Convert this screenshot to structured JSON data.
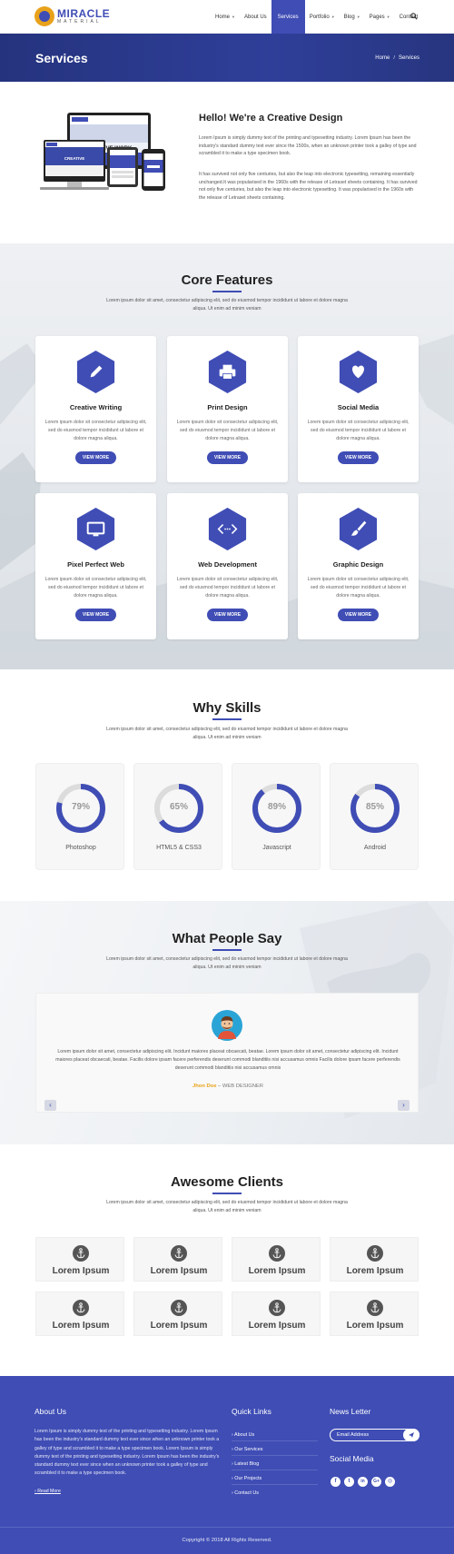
{
  "brand": {
    "name": "MIRACLE",
    "sub": "MATERIAL",
    "accent": "#3f4db5",
    "accent2": "#e8a21a"
  },
  "nav": {
    "items": [
      {
        "label": "Home",
        "caret": true
      },
      {
        "label": "About Us",
        "caret": false
      },
      {
        "label": "Services",
        "caret": false,
        "active": true
      },
      {
        "label": "Portfolio",
        "caret": true
      },
      {
        "label": "Blog",
        "caret": true
      },
      {
        "label": "Pages",
        "caret": true
      },
      {
        "label": "Contact",
        "caret": false
      }
    ],
    "caret_glyph": "▼",
    "search_icon": "search-icon"
  },
  "banner": {
    "title": "Services",
    "breadcrumb_home": "Home",
    "breadcrumb_sep": "/",
    "breadcrumb_current": "Services"
  },
  "intro": {
    "title": "Hello! We're a Creative Design",
    "p1": "Lorem Ipsum is simply dummy text of the printing and typesetting industry. Lorem Ipsum has been the industry's standard dummy text ever since the 1500s, when an unknown printer took a galley of type and scrambled it to make a type specimen book.",
    "p2": "It has survived not only five centuries, but also the leap into electronic typesetting, remaining essentially unchanged.It was popularised in the 1960s with the release of Letraset sheets containing. It has survived not only five centuries, but also the leap into electronic typesetting. It was popularised in the 1960s with the release of Letraset sheets containing.",
    "screen_text": "CREATIVE WORK",
    "screen_text2": "CREATIVE"
  },
  "features": {
    "title": "Core Features",
    "desc": "Lorem ipsum dolor sit amet, consectetur adipiscing elit, sed do eiusmod tempor incididunt ut labore et dolore magna aliqua. Ut enim ad minim veniam",
    "items": [
      {
        "name": "Creative Writing",
        "icon": "pencil-icon",
        "desc": "Lorem ipsum dolor sit consectetur adipiscing elit, sed do eiusmod tempor incididunt ut labore et dolore magna aliqua.",
        "button": "VIEW MORE"
      },
      {
        "name": "Print Design",
        "icon": "printer-icon",
        "desc": "Lorem ipsum dolor sit consectetur adipiscing elit, sed do eiusmod tempor incididunt ut labore et dolore magna aliqua.",
        "button": "VIEW MORE"
      },
      {
        "name": "Social Media",
        "icon": "heart-icon",
        "desc": "Lorem ipsum dolor sit consectetur adipiscing elit, sed do eiusmod tempor incididunt ut labore et dolore magna aliqua.",
        "button": "VIEW MORE"
      },
      {
        "name": "Pixel Perfect Web",
        "icon": "monitor-icon",
        "desc": "Lorem ipsum dolor sit consectetur adipiscing elit, sed do eiusmod tempor incididunt ut labore et dolore magna aliqua.",
        "button": "VIEW MORE"
      },
      {
        "name": "Web Development",
        "icon": "code-icon",
        "desc": "Lorem ipsum dolor sit consectetur adipiscing elit, sed do eiusmod tempor incididunt ut labore et dolore magna aliqua.",
        "button": "VIEW MORE"
      },
      {
        "name": "Graphic Design",
        "icon": "brush-icon",
        "desc": "Lorem ipsum dolor sit consectetur adipiscing elit, sed do eiusmod tempor incididunt ut labore et dolore magna aliqua.",
        "button": "VIEW MORE"
      }
    ]
  },
  "skills": {
    "title": "Why Skills",
    "desc": "Lorem ipsum dolor sit amet, consectetur adipiscing elit, sed do eiusmod tempor incididunt ut labore et dolore magna aliqua. Ut enim ad minim veniam",
    "items": [
      {
        "name": "Photoshop",
        "percent": 79,
        "label": "79%"
      },
      {
        "name": "HTML5 & CSS3",
        "percent": 65,
        "label": "65%"
      },
      {
        "name": "Javascript",
        "percent": 89,
        "label": "89%"
      },
      {
        "name": "Android",
        "percent": 85,
        "label": "85%"
      }
    ]
  },
  "testimonials": {
    "title": "What People Say",
    "desc": "Lorem ipsum dolor sit amet, consectetur adipiscing elit, sed do eiusmod tempor incididunt ut labore et dolore magna aliqua. Ut enim ad minim veniam",
    "text": "Lorem ipsum dolor sit amet, consectetur adipiscing elit. Incidunt maiores placeat obcaecati, beatae. Lorem ipsum dolor sit amet, consectetur adipiscing elit. Incidunt maiores placeat obcaecati, beatae. Facilis dolore ipsam facere perferendis deserunt commodi blanditiis nisi accusamus omnis Facilis dolore ipsam facere perferendis deserunt commodi blanditiis nisi accusamus omnis",
    "author": "Jhon Doe",
    "dash": " – ",
    "role": "WEB DESIGNER",
    "prev": "‹",
    "next": "›"
  },
  "clients": {
    "title": "Awesome Clients",
    "desc": "Lorem ipsum dolor sit amet, consectetur adipiscing elit, sed do eiusmod tempor incididunt ut labore et dolore magna aliqua. Ut enim ad minim veniam",
    "items": [
      "Lorem Ipsum",
      "Lorem Ipsum",
      "Lorem Ipsum",
      "Lorem Ipsum",
      "Lorem Ipsum",
      "Lorem Ipsum",
      "Lorem Ipsum",
      "Lorem Ipsum"
    ]
  },
  "footer": {
    "about_title": "About Us",
    "about_text": "Lorem Ipsum is simply dummy text of the printing and typesetting industry. Lorem Ipsum has been the industry's standard dummy text ever since when an unknown printer took a galley of type and scrambled it to make a type specimen book. Lorem Ipsum is simply dummy text of the printing and typesetting industry. Lorem Ipsum has been the industry's standard dummy text ever since when an unknown printer took a galley of type and scrambled it to make a type specimen book.",
    "read_more": "Read More",
    "links_title": "Quick Links",
    "links": [
      "About Us",
      "Our Services",
      "Latest Blog",
      "Our Projects",
      "Contact Us"
    ],
    "link_prefix": "›",
    "newsletter_title": "News Letter",
    "email_placeholder": "Email Address",
    "social_title": "Social Media",
    "social": [
      {
        "icon": "facebook-icon",
        "glyph": "f"
      },
      {
        "icon": "twitter-icon",
        "glyph": "t"
      },
      {
        "icon": "linkedin-icon",
        "glyph": "in"
      },
      {
        "icon": "google-plus-icon",
        "glyph": "G+"
      },
      {
        "icon": "instagram-icon",
        "glyph": "◎"
      }
    ],
    "copyright": "Copyright © 2018 All Rights Reserved."
  }
}
